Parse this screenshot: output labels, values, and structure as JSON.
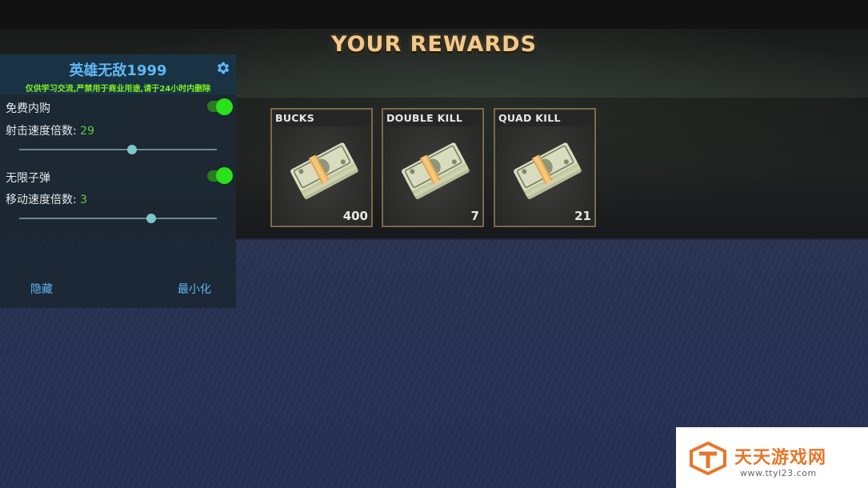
{
  "screen": {
    "title": "YOUR REWARDS"
  },
  "rewards": [
    {
      "name": "BUCKS",
      "count": "400",
      "icon": "cash-stack-icon"
    },
    {
      "name": "DOUBLE KILL",
      "count": "7",
      "icon": "cash-stack-icon"
    },
    {
      "name": "QUAD KILL",
      "count": "21",
      "icon": "cash-stack-icon"
    }
  ],
  "mod_menu": {
    "title": "英雄无敌1999",
    "subtitle": "仅供学习交流,严禁用于商业用途,请于24小时内删除",
    "settings_icon": "gear-icon",
    "options": [
      {
        "label": "免费内购",
        "type": "toggle",
        "enabled": true
      },
      {
        "label": "射击速度倍数: ",
        "value": "29",
        "type": "slider",
        "level": 0.57
      },
      {
        "label": "无限子弹",
        "type": "toggle",
        "enabled": true
      },
      {
        "label": "移动速度倍数: ",
        "value": "3",
        "type": "slider",
        "level": 0.67
      }
    ],
    "hide_label": "隐藏",
    "minimize_label": "最小化"
  },
  "colors": {
    "title_gold": "#f2c98b",
    "menu_accent": "#5fb7f5",
    "subtitle_green": "#7cf01e",
    "toggle_on": "#29e21b",
    "watermark_orange": "#e8762a"
  },
  "watermark": {
    "text": "天天游戏网",
    "url": "www.ttyl23.com"
  }
}
